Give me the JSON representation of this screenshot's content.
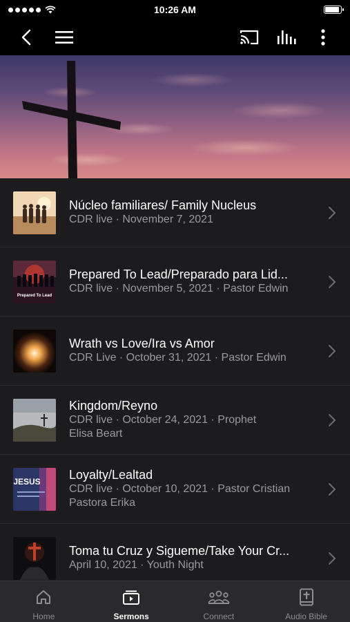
{
  "status_bar": {
    "time": "10:26 AM",
    "battery_fraction": 0.95
  },
  "nav": {
    "icons": [
      "back-arrow-icon",
      "menu-icon",
      "cast-icon",
      "audio-levels-icon",
      "more-icon"
    ]
  },
  "sermons": [
    {
      "title": "Núcleo familiares/ Family Nucleus",
      "line1": "CDR live · November 7, 2021",
      "line2": ""
    },
    {
      "title": "Prepared To Lead/Preparado para Lid...",
      "line1": "CDR live · November 5, 2021 · Pastor Edwin",
      "line2": ""
    },
    {
      "title": "Wrath vs Love/Ira vs Amor",
      "line1": "CDR Live · October 31, 2021 · Pastor Edwin",
      "line2": ""
    },
    {
      "title": "Kingdom/Reyno",
      "line1": "CDR live · October 24, 2021 · Prophet",
      "line2": "Elisa Beart"
    },
    {
      "title": "Loyalty/Lealtad",
      "line1": "CDR live · October 10, 2021 · Pastor Cristian",
      "line2": "Pastora Erika"
    },
    {
      "title": "Toma tu Cruz y Sigueme/Take Your Cr...",
      "line1": "April 10, 2021 · Youth Night",
      "line2": ""
    }
  ],
  "thumbs": {
    "prepared_text": "Prepared To Lead",
    "jesus_text": "JESUS"
  },
  "tabs": [
    {
      "label": "Home",
      "icon": "home-icon",
      "active": false
    },
    {
      "label": "Sermons",
      "icon": "sermons-icon",
      "active": true
    },
    {
      "label": "Connect",
      "icon": "connect-icon",
      "active": false
    },
    {
      "label": "Audio Bible",
      "icon": "bible-icon",
      "active": false
    }
  ],
  "colors": {
    "background": "#1c1c1e",
    "bar": "#000000",
    "tab_active": "#ffffff",
    "tab_inactive": "#8e8e93",
    "subtext": "#9a9a9f"
  }
}
